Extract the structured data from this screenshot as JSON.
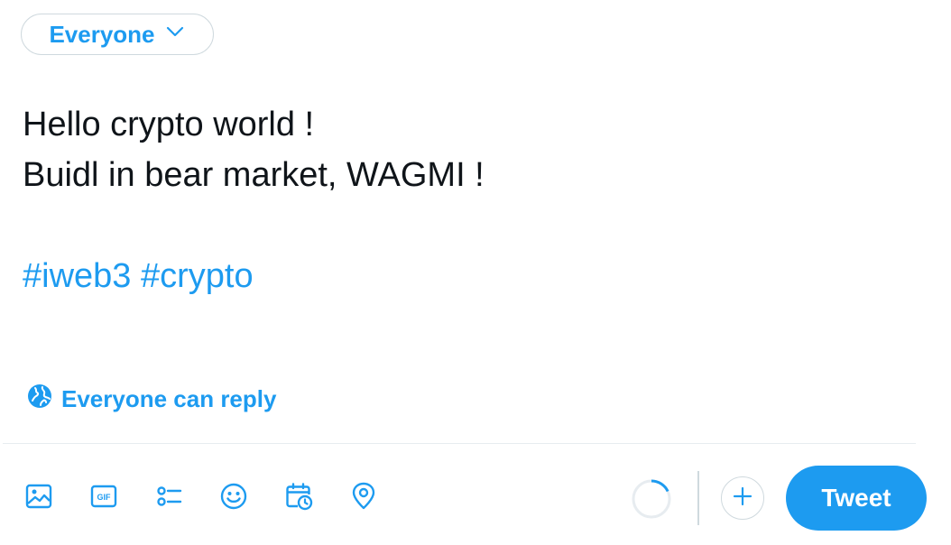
{
  "composer": {
    "audience_label": "Everyone",
    "text_lines": [
      "Hello crypto world !",
      "Buidl in bear market, WAGMI !",
      ""
    ],
    "hashtags": [
      "#iweb3",
      "#crypto"
    ],
    "reply_setting_label": "Everyone can reply"
  },
  "toolbar": {
    "icons": [
      "image-icon",
      "gif-icon",
      "poll-icon",
      "emoji-icon",
      "schedule-icon",
      "location-icon"
    ],
    "gif_label": "GIF",
    "character_progress": 0.18,
    "tweet_label": "Tweet"
  },
  "colors": {
    "accent": "#1d9bf0",
    "text": "#0f1419",
    "border": "#cfd9de"
  }
}
